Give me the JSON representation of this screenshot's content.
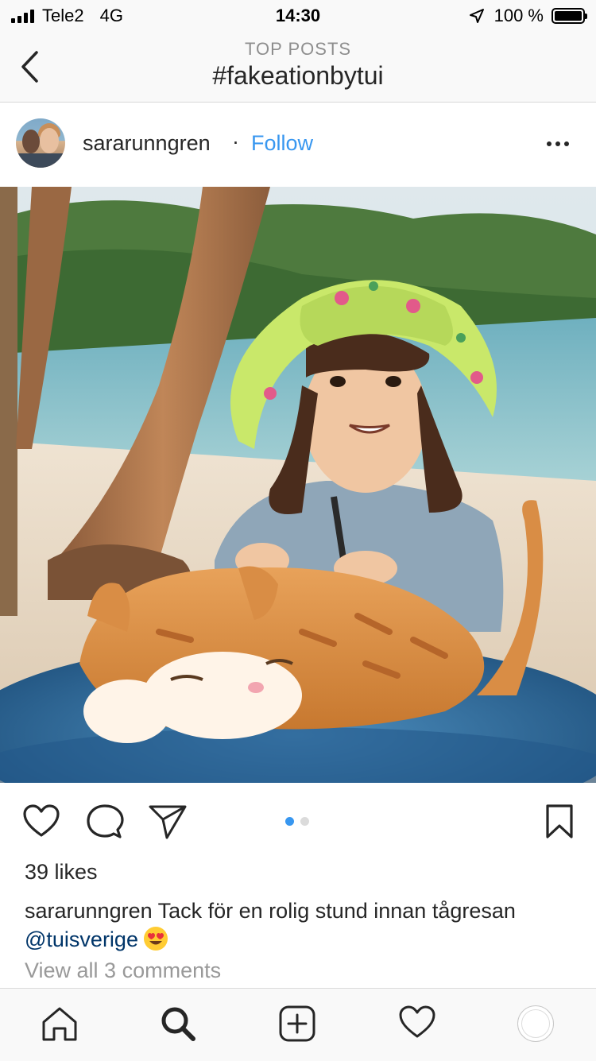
{
  "status_bar": {
    "carrier": "Tele2",
    "network": "4G",
    "time": "14:30",
    "battery_percent": "100 %",
    "icons": [
      "signal-icon",
      "location-arrow-icon",
      "battery-icon"
    ]
  },
  "header": {
    "subtitle": "TOP POSTS",
    "title": "#fakeationbytui",
    "back_icon": "chevron-left-icon"
  },
  "post": {
    "username": "sararunngren",
    "separator": "·",
    "follow_label": "Follow",
    "more_icon": "more-horizontal-icon",
    "photo_icon": "photo",
    "carousel": {
      "total": 2,
      "active": 1
    },
    "likes": "39 likes",
    "caption": {
      "user": "sararunngren",
      "text": " Tack för en rolig stund innan tågresan",
      "mention": "@tuisverige",
      "emoji": "heart-eyes-emoji"
    },
    "view_comments": "View all 3 comments",
    "action_icons": [
      "heart-icon",
      "comment-icon",
      "share-icon",
      "bookmark-icon"
    ]
  },
  "tab_bar": {
    "icons": [
      "home-icon",
      "search-icon",
      "add-icon",
      "activity-heart-icon",
      "profile-avatar-icon"
    ]
  },
  "colors": {
    "accent": "#3897f0",
    "mention": "#003569",
    "muted": "#999999",
    "text": "#262626"
  }
}
